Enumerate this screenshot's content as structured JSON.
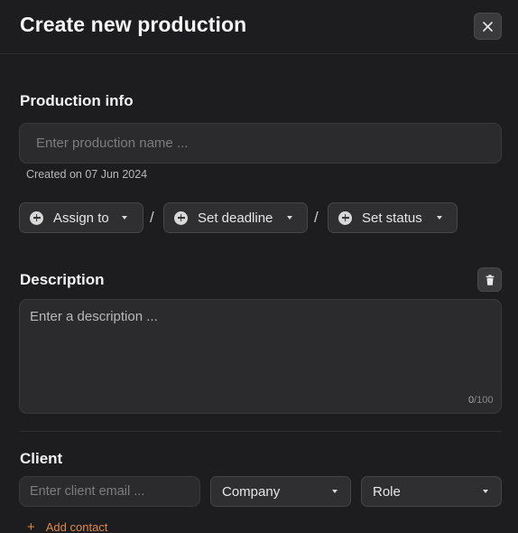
{
  "dialog": {
    "title": "Create new production"
  },
  "production_info": {
    "heading": "Production info",
    "name_placeholder": "Enter production name ...",
    "created_text": "Created on 07 Jun 2024",
    "actions": [
      {
        "label": "Assign to",
        "icon": "plus-circle-icon"
      },
      {
        "label": "Set deadline",
        "icon": "plus-circle-icon"
      },
      {
        "label": "Set status",
        "icon": "plus-circle-icon"
      }
    ],
    "separator": "/"
  },
  "description": {
    "heading": "Description",
    "placeholder": "Enter a description ...",
    "count": "0",
    "max": "/100"
  },
  "client": {
    "heading": "Client",
    "email_placeholder": "Enter client email ...",
    "company_label": "Company",
    "role_label": "Role",
    "add_contact_label": "Add contact"
  },
  "colors": {
    "background": "#1d1d1f",
    "accent": "#e0894a"
  }
}
